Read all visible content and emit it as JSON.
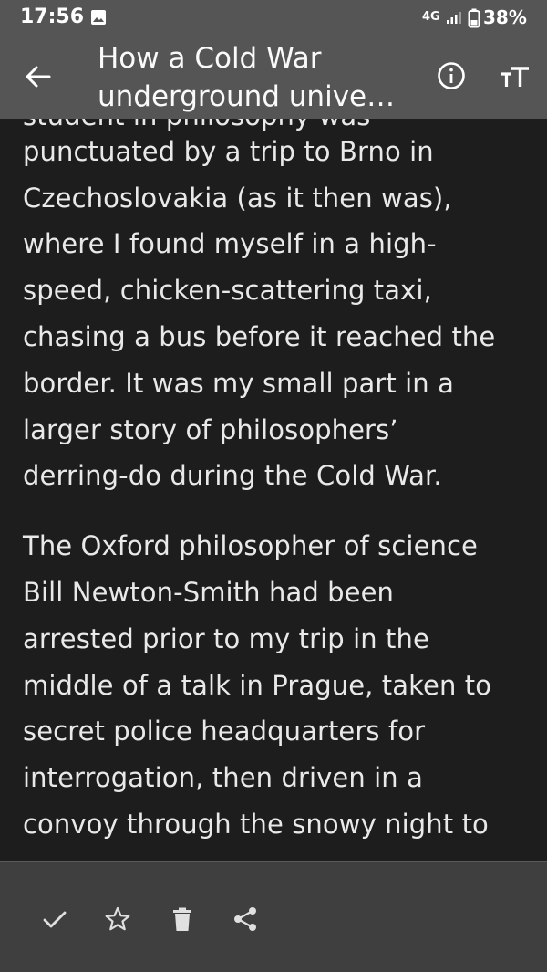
{
  "status_bar": {
    "time": "17:56",
    "network": "4G",
    "battery": "38%",
    "icons": [
      "gallery-icon",
      "signal-icon",
      "battery-icon"
    ]
  },
  "app_bar": {
    "title_lines": [
      "How a Cold War",
      "underground unive…"
    ],
    "icons": [
      "back-arrow-icon",
      "info-icon",
      "text-size-icon"
    ]
  },
  "article": {
    "partial_line": "student in philosophy was",
    "paragraphs": [
      [
        "punctuated by a trip to Brno in",
        "Czechoslovakia (as it then was),",
        "where I found myself in a high-",
        "speed, chicken-scattering taxi,",
        "chasing a bus before it reached the",
        "border. It was my small part in a",
        "larger story of philosophers’",
        "derring-do during the Cold War."
      ],
      [
        "The Oxford philosopher of science",
        "Bill Newton-Smith had been",
        "arrested prior to my trip in the",
        "middle of a talk in Prague, taken to",
        "secret police headquarters for",
        "interrogation, then driven in a",
        "convoy through the snowy night to"
      ]
    ]
  },
  "bottom_bar": {
    "icons": [
      "check-icon",
      "star-icon",
      "delete-icon",
      "share-icon"
    ]
  },
  "colors": {
    "background": "#1d1d1d",
    "bars": "#555555",
    "bottom_bar": "#3f3f3f",
    "text": "#e9e9e9"
  }
}
